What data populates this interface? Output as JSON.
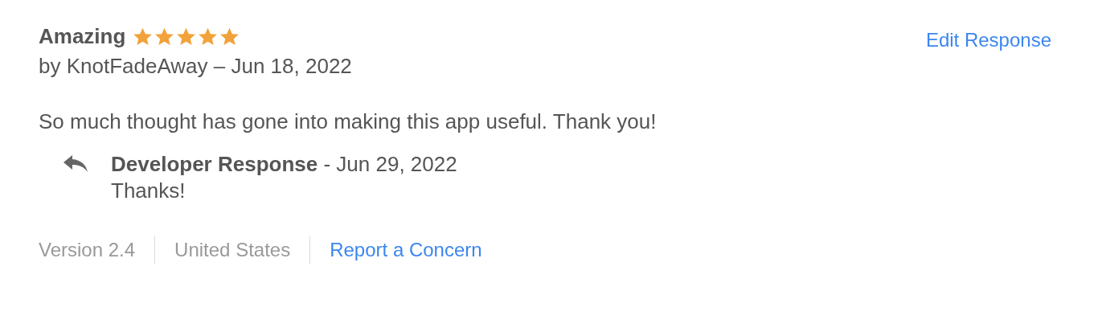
{
  "review": {
    "title": "Amazing",
    "stars": 5,
    "byline": "by KnotFadeAway – Jun 18, 2022",
    "body": "So much thought has gone into making this app useful. Thank you!"
  },
  "edit_link": "Edit Response",
  "developer_response": {
    "label": "Developer Response",
    "date": " - Jun 29, 2022",
    "text": "Thanks!"
  },
  "footer": [
    {
      "kind": "text",
      "label": "Version 2.4"
    },
    {
      "kind": "text",
      "label": "United States"
    },
    {
      "kind": "link",
      "label": "Report a Concern"
    }
  ]
}
